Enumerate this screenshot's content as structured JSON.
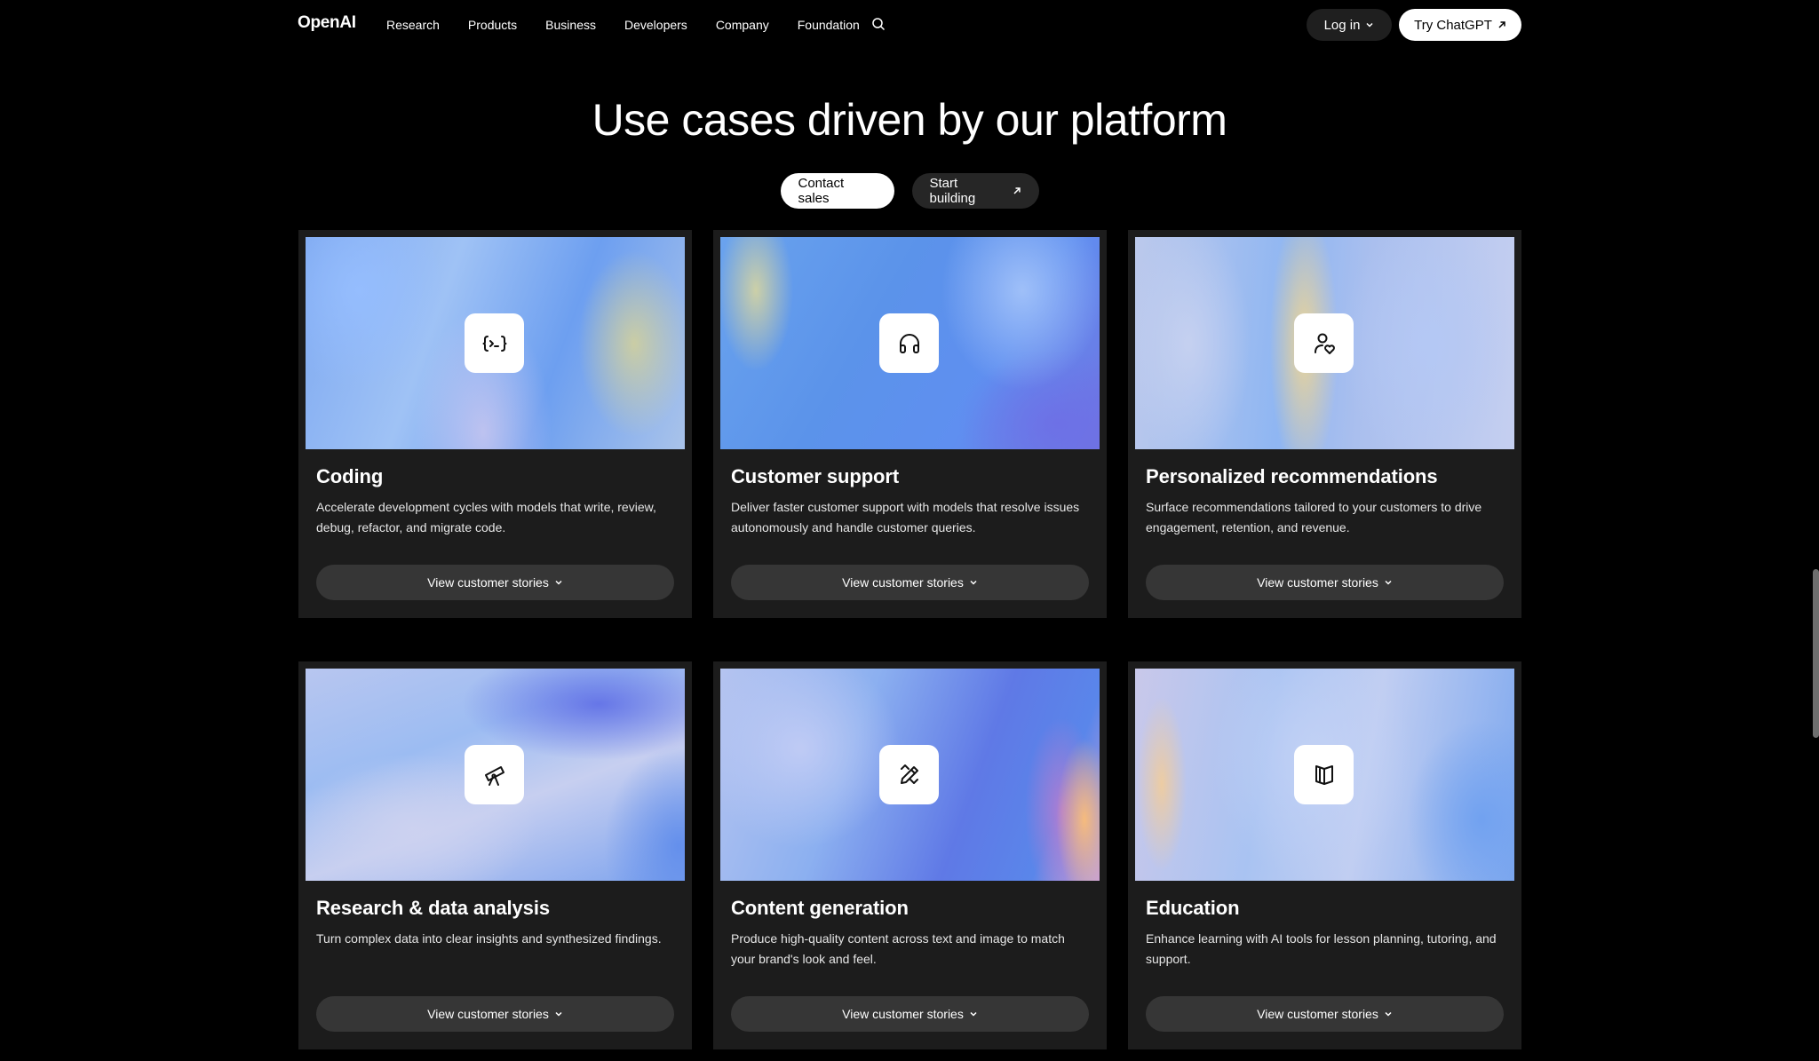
{
  "nav": {
    "logo": "OpenAI",
    "links": [
      "Research",
      "Products",
      "Business",
      "Developers",
      "Company",
      "Foundation"
    ],
    "login_label": "Log in",
    "try_label": "Try ChatGPT"
  },
  "header": {
    "title": "Use cases driven by our platform",
    "contact_label": "Contact sales",
    "start_label": "Start building"
  },
  "cards": [
    {
      "title": "Coding",
      "description": "Accelerate development cycles with models that write, review, debug, refactor, and migrate code.",
      "button_label": "View customer stories",
      "icon": "terminal-icon"
    },
    {
      "title": "Customer support",
      "description": "Deliver faster customer support with models that resolve issues autonomously and handle customer queries.",
      "button_label": "View customer stories",
      "icon": "headphones-icon"
    },
    {
      "title": "Personalized recommendations",
      "description": "Surface recommendations tailored to your customers to drive engagement, retention, and revenue.",
      "button_label": "View customer stories",
      "icon": "user-heart-icon"
    },
    {
      "title": "Research & data analysis",
      "description": "Turn complex data into clear insights and synthesized findings.",
      "button_label": "View customer stories",
      "icon": "telescope-icon"
    },
    {
      "title": "Content generation",
      "description": "Produce high-quality content across text and image to match your brand's look and feel.",
      "button_label": "View customer stories",
      "icon": "pencil-ruler-icon"
    },
    {
      "title": "Education",
      "description": "Enhance learning with AI tools for lesson planning, tutoring, and support.",
      "button_label": "View customer stories",
      "icon": "book-icon"
    }
  ],
  "colors": {
    "background": "#000000",
    "card": "#1c1c1c",
    "card_button": "#363636",
    "accent_button": "#ffffff"
  }
}
